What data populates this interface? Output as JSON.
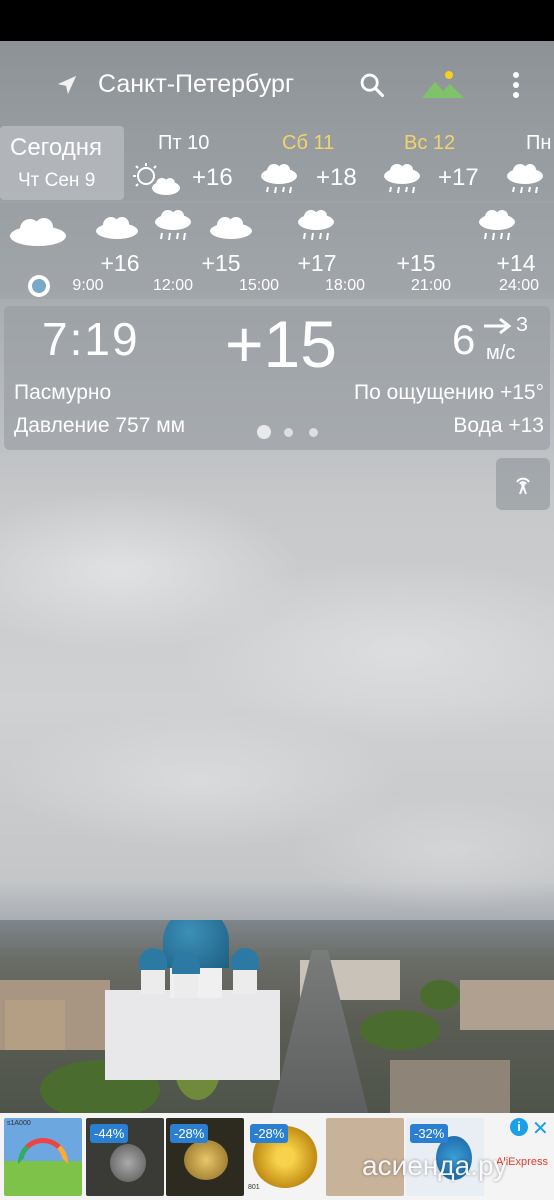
{
  "header": {
    "city": "Санкт-Петербург",
    "icons": [
      "location-arrow-icon",
      "search-icon",
      "landscape-icon",
      "more-vert-icon"
    ]
  },
  "today": {
    "label": "Сегодня",
    "date": "Чт Сен 9"
  },
  "days": [
    {
      "name": "Пт 10",
      "temp": "+16",
      "icon": "partly-cloudy-icon",
      "weekend": false
    },
    {
      "name": "Сб 11",
      "temp": "+18",
      "icon": "rain-icon",
      "weekend": true
    },
    {
      "name": "Вс 12",
      "temp": "+17",
      "icon": "rain-icon",
      "weekend": true
    },
    {
      "name": "Пн",
      "temp": "",
      "icon": "rain-icon",
      "weekend": false
    }
  ],
  "hourly": [
    {
      "time": "9:00",
      "temp": "+16"
    },
    {
      "time": "12:00",
      "temp": "+15"
    },
    {
      "time": "15:00",
      "temp": "+17"
    },
    {
      "time": "18:00",
      "temp": "+15"
    },
    {
      "time": "21:00",
      "temp": "+14"
    },
    {
      "time": "24:00",
      "temp": ""
    }
  ],
  "current": {
    "time": "7:19",
    "temp": "+15",
    "wind_speed": "6",
    "wind_dir": "З",
    "wind_unit": "м/с",
    "condition": "Пасмурно",
    "feels_like": "По ощущению +15°",
    "pressure": "Давление 757 мм",
    "water": "Вода +13"
  },
  "pager": {
    "pages": 3,
    "active": 1
  },
  "ad": {
    "badges": [
      "-44%",
      "-28%",
      "-28%",
      "-32%"
    ],
    "brand": "AliExpress",
    "info": "i",
    "close": "✕",
    "first_tile_caption": "s1A000",
    "third_tile_caption": "801"
  },
  "watermark": "асиенда.ру",
  "colors": {
    "weekend": "#f3d36b",
    "ad_accent": "#19a0e6",
    "dome": "#1c5f83"
  }
}
